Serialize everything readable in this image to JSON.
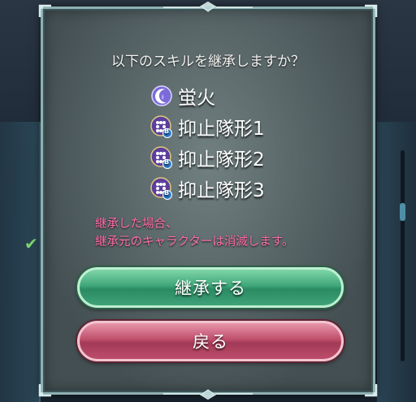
{
  "dialog": {
    "question": "以下のスキルを継承しますか？",
    "skills": [
      {
        "name": "蛍火",
        "icon": "moon-flame-icon"
      },
      {
        "name": "抑止隊形1",
        "icon": "dots-b-skill-icon",
        "slot": "B"
      },
      {
        "name": "抑止隊形2",
        "icon": "dots-b-skill-icon",
        "slot": "B"
      },
      {
        "name": "抑止隊形3",
        "icon": "dots-b-skill-icon",
        "slot": "B"
      }
    ],
    "warning_line1": "継承した場合、",
    "warning_line2": "継承元のキャラクターは消滅します。",
    "confirm_label": "継承する",
    "back_label": "戻る"
  },
  "colors": {
    "warning": "#ff6fa8",
    "confirm_button": "#3fa77a",
    "back_button": "#bf4f6c"
  }
}
